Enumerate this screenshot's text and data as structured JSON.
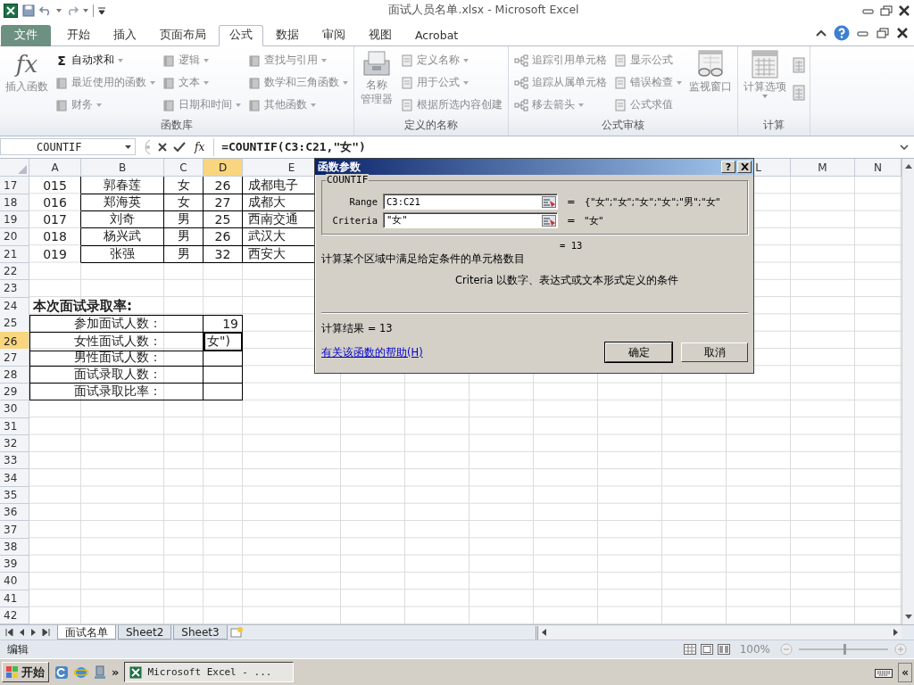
{
  "window": {
    "title": "面试人员名单.xlsx - Microsoft Excel"
  },
  "ribbon_tabs": [
    {
      "label": "文件",
      "kind": "file",
      "selected": false
    },
    {
      "label": "开始",
      "kind": "tab",
      "selected": false
    },
    {
      "label": "插入",
      "kind": "tab",
      "selected": false
    },
    {
      "label": "页面布局",
      "kind": "tab",
      "selected": false
    },
    {
      "label": "公式",
      "kind": "tab",
      "selected": true
    },
    {
      "label": "数据",
      "kind": "tab",
      "selected": false
    },
    {
      "label": "审阅",
      "kind": "tab",
      "selected": false
    },
    {
      "label": "视图",
      "kind": "tab",
      "selected": false
    },
    {
      "label": "Acrobat",
      "kind": "tab",
      "selected": false
    }
  ],
  "ribbon_groups": [
    {
      "label": "函数库",
      "items": [
        {
          "kind": "large",
          "label": "插入函数",
          "glyph": "fx",
          "dropdown": false,
          "disabled": true
        },
        {
          "kind": "column",
          "buttons": [
            {
              "label": "自动求和",
              "glyph": "Σ",
              "dropdown": true,
              "disabled": false
            },
            {
              "label": "最近使用的函数",
              "dropdown": true,
              "disabled": true
            },
            {
              "label": "财务",
              "dropdown": true,
              "disabled": true
            }
          ]
        },
        {
          "kind": "column",
          "buttons": [
            {
              "label": "逻辑",
              "dropdown": true,
              "disabled": true
            },
            {
              "label": "文本",
              "dropdown": true,
              "disabled": true
            },
            {
              "label": "日期和时间",
              "dropdown": true,
              "disabled": true
            }
          ]
        },
        {
          "kind": "column",
          "buttons": [
            {
              "label": "查找与引用",
              "dropdown": true,
              "disabled": true
            },
            {
              "label": "数学和三角函数",
              "dropdown": true,
              "disabled": true
            },
            {
              "label": "其他函数",
              "dropdown": true,
              "disabled": true
            }
          ]
        }
      ]
    },
    {
      "label": "定义的名称",
      "items": [
        {
          "kind": "large",
          "lines": [
            "名称",
            "管理器"
          ],
          "dropdown": false,
          "disabled": true
        },
        {
          "kind": "column",
          "buttons": [
            {
              "label": "定义名称",
              "dropdown": true,
              "disabled": true
            },
            {
              "label": "用于公式",
              "dropdown": true,
              "disabled": true
            },
            {
              "label": "根据所选内容创建",
              "dropdown": false,
              "disabled": true
            }
          ]
        }
      ]
    },
    {
      "label": "公式审核",
      "items": [
        {
          "kind": "column",
          "buttons": [
            {
              "label": "追踪引用单元格",
              "dropdown": false,
              "disabled": true
            },
            {
              "label": "追踪从属单元格",
              "dropdown": false,
              "disabled": true
            },
            {
              "label": "移去箭头",
              "dropdown": true,
              "disabled": true
            }
          ]
        },
        {
          "kind": "column",
          "buttons": [
            {
              "label": "显示公式",
              "dropdown": false,
              "disabled": true
            },
            {
              "label": "错误检查",
              "dropdown": true,
              "disabled": true
            },
            {
              "label": "公式求值",
              "dropdown": false,
              "disabled": true
            }
          ]
        },
        {
          "kind": "large",
          "label": "监视窗口",
          "dropdown": false,
          "disabled": true
        }
      ]
    },
    {
      "label": "计算",
      "items": [
        {
          "kind": "large",
          "label": "计算选项",
          "dropdown": true,
          "disabled": true
        },
        {
          "kind": "icons",
          "buttons": [
            {
              "disabled": true
            },
            {
              "disabled": true
            }
          ]
        }
      ]
    }
  ],
  "formula_bar": {
    "name_box": "COUNTIF",
    "fx_glyph": "fx",
    "formula": "=COUNTIF(C3:C21,\"女\")"
  },
  "columns": [
    {
      "label": "A",
      "selected": false
    },
    {
      "label": "B",
      "selected": false
    },
    {
      "label": "C",
      "selected": false
    },
    {
      "label": "D",
      "selected": true
    },
    {
      "label": "E",
      "selected": false
    },
    {
      "label": "L",
      "selected": false
    },
    {
      "label": "M",
      "selected": false
    },
    {
      "label": "N",
      "selected": false
    }
  ],
  "rows": [
    {
      "kind": "data",
      "number": "17",
      "selected": false,
      "cells": [
        "015",
        "郭春莲",
        "女",
        "26",
        "成都电子"
      ]
    },
    {
      "kind": "data",
      "number": "18",
      "selected": false,
      "cells": [
        "016",
        "郑海英",
        "女",
        "27",
        "成都大"
      ]
    },
    {
      "kind": "data",
      "number": "19",
      "selected": false,
      "cells": [
        "017",
        "刘奇",
        "男",
        "25",
        "西南交通"
      ]
    },
    {
      "kind": "data",
      "number": "20",
      "selected": false,
      "cells": [
        "018",
        "杨兴武",
        "男",
        "26",
        "武汉大"
      ]
    },
    {
      "kind": "data",
      "number": "21",
      "selected": false,
      "cells": [
        "019",
        "张强",
        "男",
        "32",
        "西安大"
      ]
    },
    {
      "kind": "empty",
      "number": "22",
      "selected": false
    },
    {
      "kind": "empty",
      "number": "23",
      "selected": false
    },
    {
      "kind": "heading",
      "number": "24",
      "selected": false,
      "text": "本次面试录取率:"
    },
    {
      "kind": "summary",
      "number": "25",
      "selected": false,
      "label": "参加面试人数：",
      "value": "19"
    },
    {
      "kind": "summary",
      "number": "26",
      "selected": true,
      "label": "女性面试人数：",
      "value": "女\")"
    },
    {
      "kind": "summary",
      "number": "27",
      "selected": false,
      "label": "男性面试人数："
    },
    {
      "kind": "summary",
      "number": "28",
      "selected": false,
      "label": "面试录取人数："
    },
    {
      "kind": "summary",
      "number": "29",
      "selected": false,
      "label": "面试录取比率："
    },
    {
      "kind": "empty",
      "number": "30",
      "selected": false
    },
    {
      "kind": "empty",
      "number": "31",
      "selected": false
    },
    {
      "kind": "empty",
      "number": "32",
      "selected": false
    },
    {
      "kind": "empty",
      "number": "33",
      "selected": false
    },
    {
      "kind": "empty",
      "number": "34",
      "selected": false
    },
    {
      "kind": "empty",
      "number": "35",
      "selected": false
    },
    {
      "kind": "empty",
      "number": "36",
      "selected": false
    },
    {
      "kind": "empty",
      "number": "37",
      "selected": false
    },
    {
      "kind": "empty",
      "number": "38",
      "selected": false
    },
    {
      "kind": "empty",
      "number": "39",
      "selected": false
    },
    {
      "kind": "empty",
      "number": "40",
      "selected": false
    },
    {
      "kind": "empty",
      "number": "41",
      "selected": false
    },
    {
      "kind": "empty",
      "number": "42",
      "selected": false
    }
  ],
  "dialog": {
    "title": "函数参数",
    "help": "?",
    "function": "COUNTIF",
    "arguments": [
      {
        "name": "Range",
        "value": "C3:C21",
        "sign": "=",
        "result": "{\"女\";\"女\";\"女\";\"女\";\"男\";\"女\""
      },
      {
        "name": "Criteria",
        "value": "\"女\"",
        "sign": "=",
        "result": "\"女\""
      }
    ],
    "formula_result": "= 13",
    "description": "计算某个区域中满足给定条件的单元格数目",
    "argument_help": "Criteria  以数字、表达式或文本形式定义的条件",
    "calc_result": "计算结果 = 13",
    "help_link": "有关该函数的帮助(H)",
    "buttons": [
      "确定",
      "取消"
    ]
  },
  "sheet_tabs": [
    {
      "label": "面试名单",
      "selected": true
    },
    {
      "label": "Sheet2",
      "selected": false
    },
    {
      "label": "Sheet3",
      "selected": false
    }
  ],
  "status_bar": {
    "mode": "编辑",
    "zoom": "100%",
    "zoom_slider": {
      "level": 0.5
    }
  },
  "taskbar": {
    "start": "开始",
    "more": "»",
    "task": "Microsoft Excel - ...",
    "tray_toggle": "«"
  }
}
